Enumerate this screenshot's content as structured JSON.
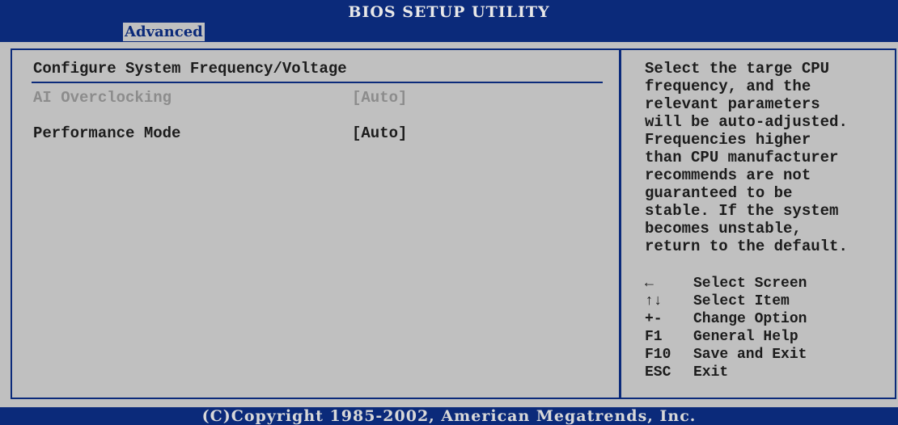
{
  "header": {
    "title": "BIOS SETUP UTILITY",
    "active_tab": "Advanced"
  },
  "main": {
    "section_title": "Configure System Frequency/Voltage",
    "items": [
      {
        "label": "AI Overclocking",
        "value": "[Auto]",
        "enabled": false
      },
      {
        "label": "Performance Mode",
        "value": "[Auto]",
        "enabled": true
      }
    ]
  },
  "help": {
    "text": "Select the targe CPU\nfrequency, and the\nrelevant parameters\nwill be auto-adjusted.\nFrequencies higher\nthan CPU manufacturer\nrecommends are not\nguaranteed to be\nstable. If the system\nbecomes unstable,\nreturn to the default."
  },
  "keys": [
    {
      "key": "←",
      "desc": "Select Screen"
    },
    {
      "key": "↑↓",
      "desc": "Select Item"
    },
    {
      "key": "+-",
      "desc": "Change Option"
    },
    {
      "key": "F1",
      "desc": "General Help"
    },
    {
      "key": "F10",
      "desc": "Save and Exit"
    },
    {
      "key": "ESC",
      "desc": "Exit"
    }
  ],
  "footer": {
    "copyright": "(C)Copyright 1985-2002, American Megatrends, Inc."
  },
  "colors": {
    "background": "#c0c0c0",
    "accent": "#0b2a7a",
    "disabled_text": "#8c8c8c"
  }
}
